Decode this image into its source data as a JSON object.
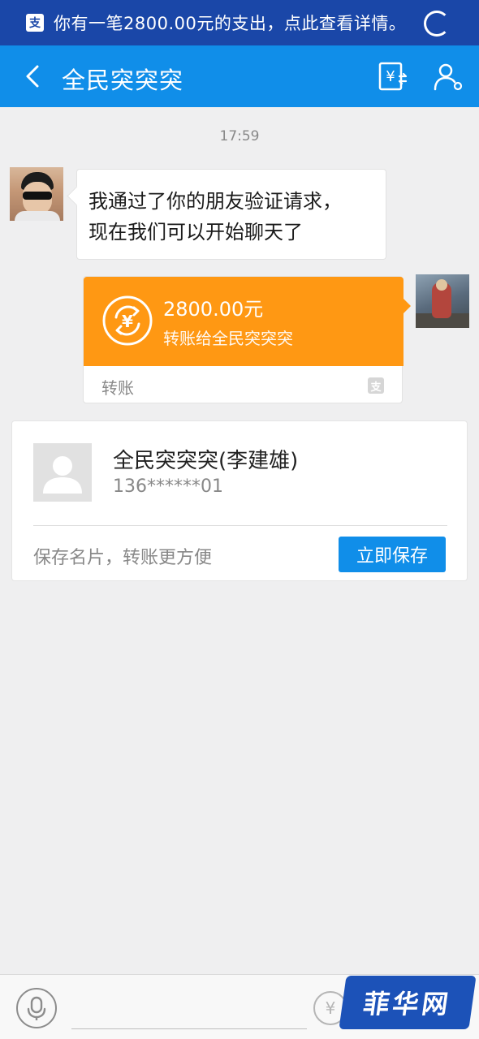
{
  "notification": {
    "icon": "alipay-logo-icon",
    "text": "你有一笔2800.00元的支出，点此查看详情。"
  },
  "header": {
    "title": "全民突突突",
    "icons": [
      "back-icon",
      "transfer-icon",
      "profile-icon"
    ],
    "color": "#108ee9"
  },
  "chat": {
    "timestamp": "17:59",
    "messages": [
      {
        "from": "contact",
        "text_line1": "我通过了你的朋友验证请求，",
        "text_line2": "现在我们可以开始聊天了"
      }
    ],
    "transfer": {
      "amount": "2800.00元",
      "description": "转账给全民突突突",
      "label": "转账",
      "color": "#ff9813"
    }
  },
  "contact_card": {
    "name": "全民突突突(李建雄)",
    "phone": "136******01",
    "hint": "保存名片，转账更方便",
    "save_button": "立即保存"
  },
  "input_bar": {
    "icons": [
      "mic-icon",
      "yuan-icon"
    ]
  },
  "watermark": {
    "text": "菲华网"
  }
}
